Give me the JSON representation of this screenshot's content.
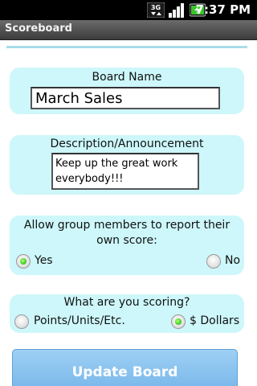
{
  "status_bar": {
    "network_label": "3G",
    "time": "7:37 PM"
  },
  "title_bar": {
    "title": "Scoreboard"
  },
  "board_name": {
    "label": "Board Name",
    "value": "March Sales"
  },
  "description": {
    "label": "Description/Announcement",
    "value_line1": "Keep up the great work",
    "value_line2": "everybody!!!"
  },
  "allow_report": {
    "label_line1": "Allow group members to report their",
    "label_line2": "own score:",
    "options": [
      {
        "label": "Yes",
        "selected": true
      },
      {
        "label": "No",
        "selected": false
      }
    ]
  },
  "scoring": {
    "label": "What are you scoring?",
    "options": [
      {
        "label": "Points/Units/Etc.",
        "selected": false
      },
      {
        "label": "$ Dollars",
        "selected": true
      }
    ]
  },
  "update_button": {
    "label": "Update Board"
  },
  "colors": {
    "panel": "#cdf7fa",
    "divider": "#a8dce9",
    "button": "#8cc4ef",
    "radio_checked": "#3fcf2a"
  }
}
